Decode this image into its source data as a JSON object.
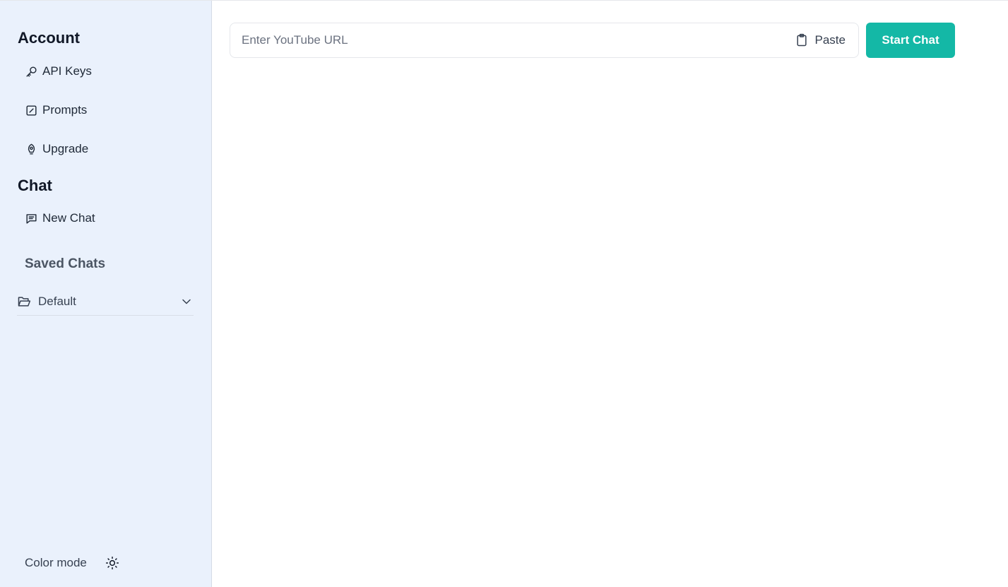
{
  "sidebar": {
    "account_title": "Account",
    "account_items": [
      {
        "label": "API Keys",
        "icon": "key-icon"
      },
      {
        "label": "Prompts",
        "icon": "edit-square-icon"
      },
      {
        "label": "Upgrade",
        "icon": "rocket-icon"
      }
    ],
    "chat_title": "Chat",
    "chat_items": [
      {
        "label": "New Chat",
        "icon": "message-square-icon"
      }
    ],
    "saved_chats_title": "Saved Chats",
    "folders": [
      {
        "label": "Default",
        "icon": "folder-open-icon"
      }
    ],
    "color_mode_label": "Color mode"
  },
  "main": {
    "url_input": {
      "placeholder": "Enter YouTube URL",
      "value": ""
    },
    "paste_label": "Paste",
    "start_label": "Start Chat"
  },
  "colors": {
    "sidebar_bg": "#eaf1fc",
    "accent": "#14b8a6"
  }
}
